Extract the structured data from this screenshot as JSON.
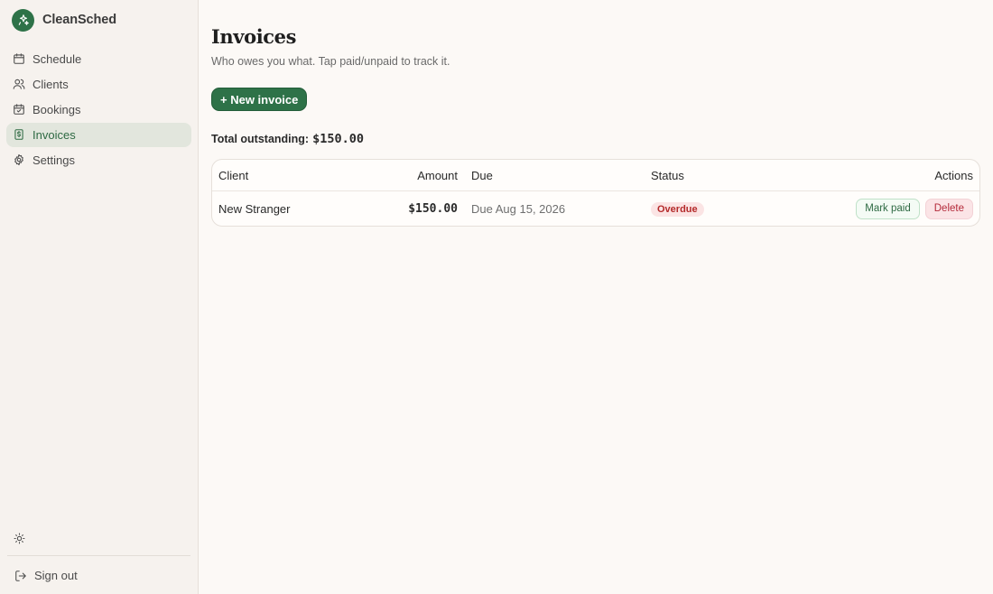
{
  "app": {
    "name": "CleanSched"
  },
  "nav": {
    "items": [
      {
        "label": "Schedule",
        "icon": "calendar-icon"
      },
      {
        "label": "Clients",
        "icon": "users-icon"
      },
      {
        "label": "Bookings",
        "icon": "calendar-check-icon"
      },
      {
        "label": "Invoices",
        "icon": "receipt-icon",
        "active": true
      },
      {
        "label": "Settings",
        "icon": "gear-icon"
      }
    ],
    "signout_label": "Sign out"
  },
  "page": {
    "title": "Invoices",
    "subtitle": "Who owes you what. Tap paid/unpaid to track it.",
    "new_button_label": "+ New invoice",
    "total_label": "Total outstanding:",
    "total_value": "$150.00"
  },
  "table": {
    "headers": {
      "client": "Client",
      "amount": "Amount",
      "due": "Due",
      "status": "Status",
      "actions": "Actions"
    },
    "rows": [
      {
        "client": "New Stranger",
        "amount": "$150.00",
        "due": "Due Aug 15, 2026",
        "status": "Overdue",
        "mark_paid_label": "Mark paid",
        "delete_label": "Delete"
      }
    ]
  },
  "colors": {
    "brand": "#2e7248",
    "overdue": "#b42a2a"
  }
}
